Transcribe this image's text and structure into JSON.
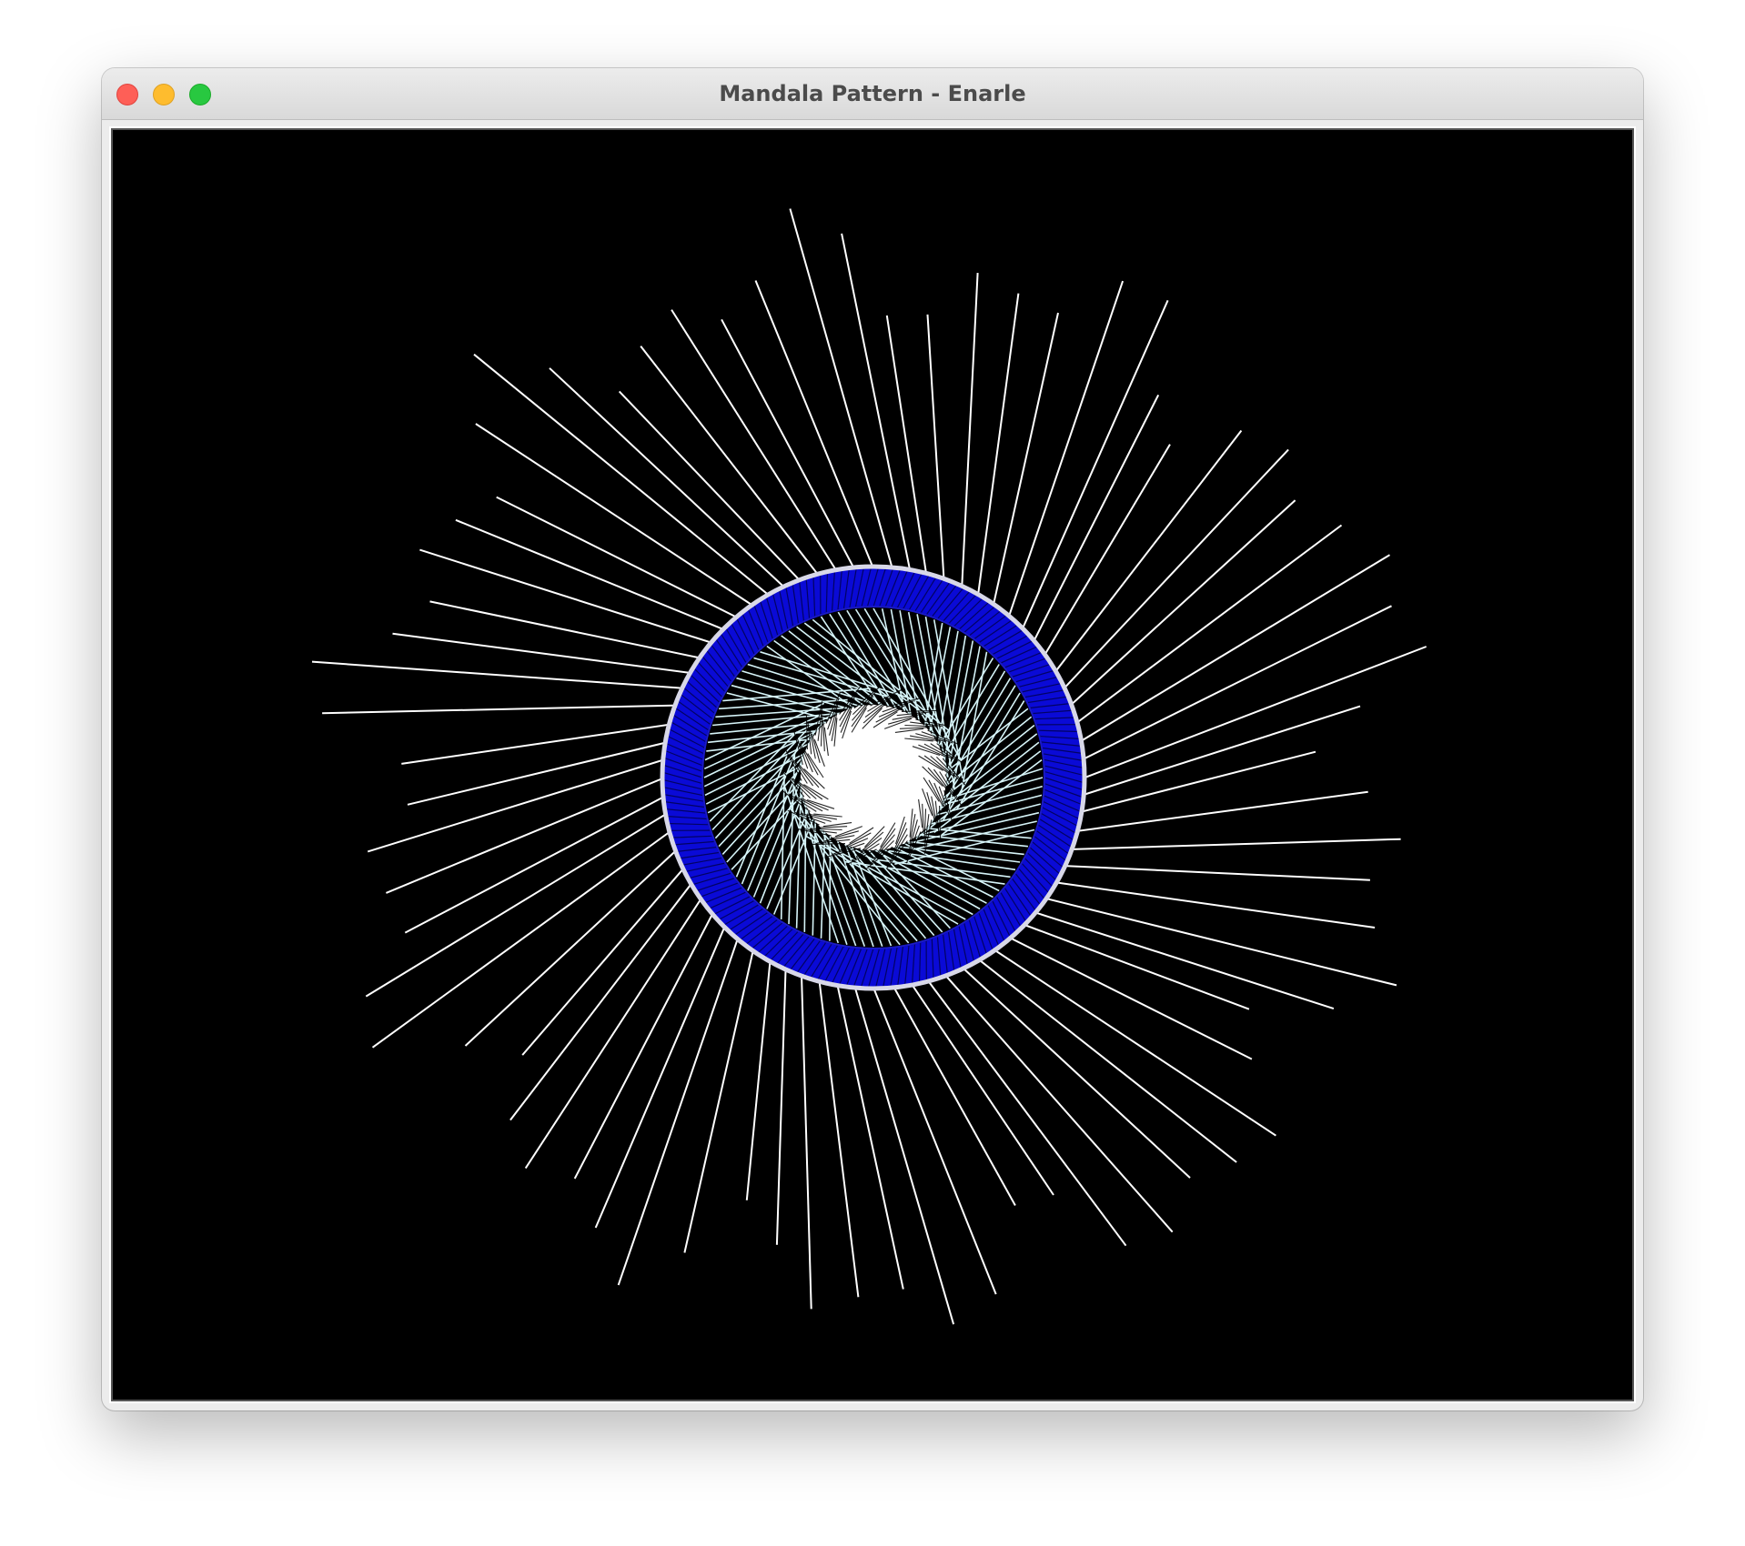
{
  "window": {
    "title": "Mandala Pattern - Enarle",
    "controls": {
      "close_color": "#fe5f57",
      "minimize_color": "#febc2e",
      "zoom_color": "#28c840"
    }
  },
  "canvas": {
    "background": "#000000",
    "colors": {
      "outer_rays": "#ffffff",
      "ring_fill": "#0a0ad6",
      "ring_outline": "#d8d8e8",
      "inner_lines": "#d6f4f8",
      "core": "#ffffff"
    },
    "counts": {
      "outer_rays": 72,
      "ring_spokes": 180,
      "inner_lines": 120
    }
  }
}
